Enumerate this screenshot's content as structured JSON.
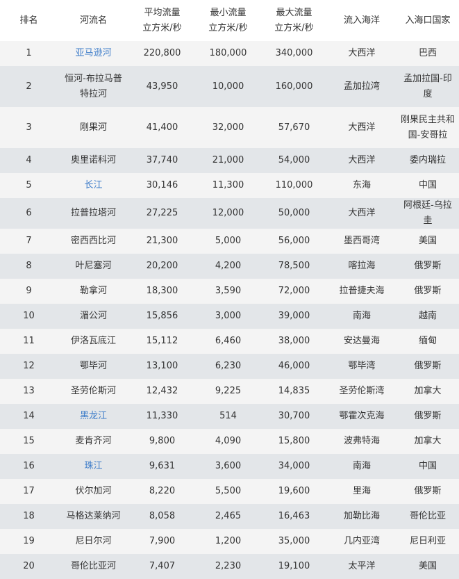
{
  "headers": [
    {
      "line1": "排名",
      "line2": ""
    },
    {
      "line1": "河流名",
      "line2": ""
    },
    {
      "line1": "平均流量",
      "line2": "立方米/秒"
    },
    {
      "line1": "最小流量",
      "line2": "立方米/秒"
    },
    {
      "line1": "最大流量",
      "line2": "立方米/秒"
    },
    {
      "line1": "流入海洋",
      "line2": ""
    },
    {
      "line1": "入海口国家",
      "line2": ""
    }
  ],
  "rows": [
    {
      "rank": "1",
      "name": "亚马逊河",
      "link": true,
      "avg": "220,800",
      "min": "180,000",
      "max": "340,000",
      "ocean": "大西洋",
      "country": "巴西"
    },
    {
      "rank": "2",
      "name": "恒河-布拉马普特拉河",
      "link": false,
      "avg": "43,950",
      "min": "10,000",
      "max": "160,000",
      "ocean": "孟加拉湾",
      "country": "孟加拉国-印度"
    },
    {
      "rank": "3",
      "name": "刚果河",
      "link": false,
      "avg": "41,400",
      "min": "32,000",
      "max": "57,670",
      "ocean": "大西洋",
      "country": "刚果民主共和国-安哥拉"
    },
    {
      "rank": "4",
      "name": "奥里诺科河",
      "link": false,
      "avg": "37,740",
      "min": "21,000",
      "max": "54,000",
      "ocean": "大西洋",
      "country": "委内瑞拉"
    },
    {
      "rank": "5",
      "name": "长江",
      "link": true,
      "avg": "30,146",
      "min": "11,300",
      "max": "110,000",
      "ocean": "东海",
      "country": "中国"
    },
    {
      "rank": "6",
      "name": "拉普拉塔河",
      "link": false,
      "avg": "27,225",
      "min": "12,000",
      "max": "50,000",
      "ocean": "大西洋",
      "country": "阿根廷-乌拉圭"
    },
    {
      "rank": "7",
      "name": "密西西比河",
      "link": false,
      "avg": "21,300",
      "min": "5,000",
      "max": "56,000",
      "ocean": "墨西哥湾",
      "country": "美国"
    },
    {
      "rank": "8",
      "name": "叶尼塞河",
      "link": false,
      "avg": "20,200",
      "min": "4,200",
      "max": "78,500",
      "ocean": "喀拉海",
      "country": "俄罗斯"
    },
    {
      "rank": "9",
      "name": "勒拿河",
      "link": false,
      "avg": "18,300",
      "min": "3,590",
      "max": "72,000",
      "ocean": "拉普捷夫海",
      "country": "俄罗斯"
    },
    {
      "rank": "10",
      "name": "湄公河",
      "link": false,
      "avg": "15,856",
      "min": "3,000",
      "max": "39,000",
      "ocean": "南海",
      "country": "越南"
    },
    {
      "rank": "11",
      "name": "伊洛瓦底江",
      "link": false,
      "avg": "15,112",
      "min": "6,460",
      "max": "38,000",
      "ocean": "安达曼海",
      "country": "缅甸"
    },
    {
      "rank": "12",
      "name": "鄂毕河",
      "link": false,
      "avg": "13,100",
      "min": "6,230",
      "max": "46,000",
      "ocean": "鄂毕湾",
      "country": "俄罗斯"
    },
    {
      "rank": "13",
      "name": "圣劳伦斯河",
      "link": false,
      "avg": "12,432",
      "min": "9,225",
      "max": "14,835",
      "ocean": "圣劳伦斯湾",
      "country": "加拿大"
    },
    {
      "rank": "14",
      "name": "黑龙江",
      "link": true,
      "avg": "11,330",
      "min": "514",
      "max": "30,700",
      "ocean": "鄂霍次克海",
      "country": "俄罗斯"
    },
    {
      "rank": "15",
      "name": "麦肯齐河",
      "link": false,
      "avg": "9,800",
      "min": "4,090",
      "max": "15,800",
      "ocean": "波弗特海",
      "country": "加拿大"
    },
    {
      "rank": "16",
      "name": "珠江",
      "link": true,
      "avg": "9,631",
      "min": "3,600",
      "max": "34,000",
      "ocean": "南海",
      "country": "中国"
    },
    {
      "rank": "17",
      "name": "伏尔加河",
      "link": false,
      "avg": "8,220",
      "min": "5,500",
      "max": "19,600",
      "ocean": "里海",
      "country": "俄罗斯"
    },
    {
      "rank": "18",
      "name": "马格达莱纳河",
      "link": false,
      "avg": "8,058",
      "min": "2,465",
      "max": "16,463",
      "ocean": "加勒比海",
      "country": "哥伦比亚"
    },
    {
      "rank": "19",
      "name": "尼日尔河",
      "link": false,
      "avg": "7,900",
      "min": "1,200",
      "max": "35,000",
      "ocean": "几内亚湾",
      "country": "尼日利亚"
    },
    {
      "rank": "20",
      "name": "哥伦比亚河",
      "link": false,
      "avg": "7,407",
      "min": "2,230",
      "max": "19,100",
      "ocean": "太平洋",
      "country": "美国"
    }
  ]
}
